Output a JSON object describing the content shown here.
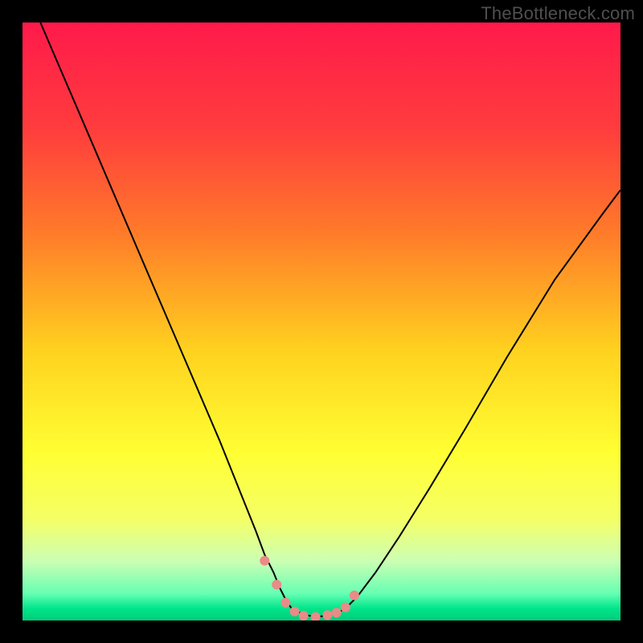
{
  "watermark": "TheBottleneck.com",
  "chart_data": {
    "type": "line",
    "title": "",
    "xlabel": "",
    "ylabel": "",
    "xlim": [
      0,
      100
    ],
    "ylim": [
      0,
      100
    ],
    "grid": false,
    "background_gradient": {
      "stops": [
        {
          "pos": 0.0,
          "color": "#ff1a4b"
        },
        {
          "pos": 0.18,
          "color": "#ff3d3d"
        },
        {
          "pos": 0.35,
          "color": "#ff7a2a"
        },
        {
          "pos": 0.55,
          "color": "#ffd21f"
        },
        {
          "pos": 0.72,
          "color": "#ffff33"
        },
        {
          "pos": 0.83,
          "color": "#f5ff66"
        },
        {
          "pos": 0.9,
          "color": "#ccffb3"
        },
        {
          "pos": 0.955,
          "color": "#66ffb3"
        },
        {
          "pos": 0.98,
          "color": "#00e58a"
        },
        {
          "pos": 1.0,
          "color": "#00cc7a"
        }
      ]
    },
    "series": [
      {
        "name": "curve",
        "color": "#000000",
        "width": 2,
        "x": [
          3,
          6,
          9,
          12,
          15,
          18,
          21,
          24,
          27,
          30,
          33,
          35,
          37,
          39,
          40.5,
          42,
          43,
          44,
          45,
          47,
          49,
          51,
          52.5,
          54,
          56,
          59,
          63,
          68,
          74,
          81,
          89,
          97,
          100
        ],
        "y": [
          100,
          93,
          86,
          79,
          72,
          65,
          58,
          51,
          44,
          37,
          30,
          25,
          20,
          15,
          11,
          8,
          5.5,
          3.5,
          2,
          1,
          0.6,
          0.8,
          1.2,
          2,
          4,
          8,
          14,
          22,
          32,
          44,
          57,
          68,
          72
        ]
      },
      {
        "name": "marker-dots",
        "color": "#e98b87",
        "type": "scatter",
        "radius": 6,
        "x": [
          40.5,
          42.5,
          44,
          45.5,
          47,
          49,
          51,
          52.5,
          54,
          55.5
        ],
        "y": [
          10,
          6,
          3,
          1.5,
          0.8,
          0.6,
          0.9,
          1.3,
          2.2,
          4.2
        ]
      }
    ]
  }
}
